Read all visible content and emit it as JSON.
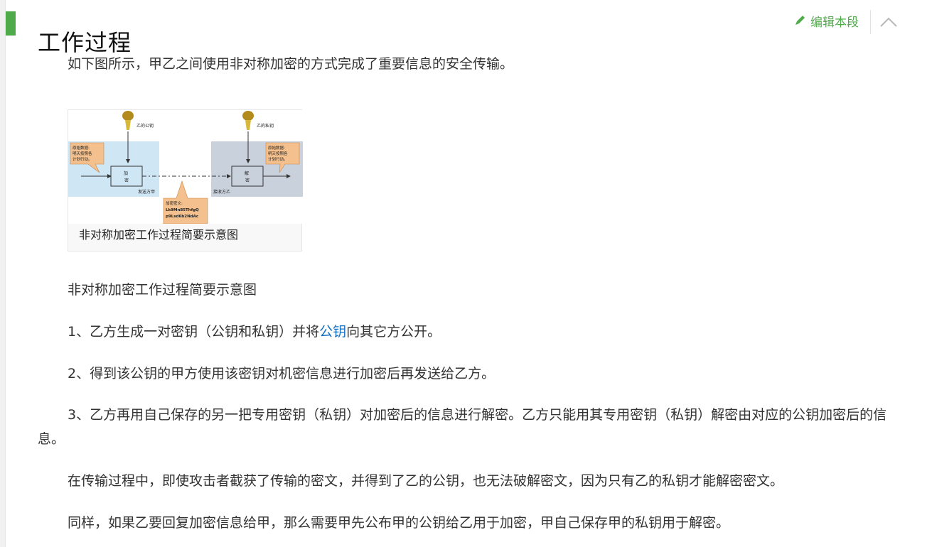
{
  "header": {
    "title": "工作过程",
    "edit_label": "编辑本段",
    "icons": {
      "edit": "pencil-icon",
      "collapse": "chevron-up-icon"
    },
    "accent_color": "#4fab49"
  },
  "intro": "如下图所示，甲乙之间使用非对称加密的方式完成了重要信息的安全传输。",
  "figure": {
    "caption": "非对称加密工作过程简要示意图",
    "diagram": {
      "public_key_label": "乙的公钥",
      "private_key_label": "乙的私钥",
      "plain_note_left": [
        "原始数据:",
        "明天按照各",
        "计划行动。"
      ],
      "plain_note_right": [
        "原始数据:",
        "明天按照各",
        "计划行动。"
      ],
      "encrypt_box": [
        "加",
        "密"
      ],
      "decrypt_box": [
        "解",
        "密"
      ],
      "sender_label": "发送方甲",
      "receiver_label": "接收方乙",
      "cipher_note": [
        "加密密文:",
        "Lk9Mn85ThfgQ",
        "p9Lsd6b2NdAc"
      ]
    }
  },
  "text_caption": "非对称加密工作过程简要示意图",
  "steps": {
    "step1_a": "1、乙方生成一对密钥（公钥和私钥）并将",
    "step1_link": "公钥",
    "step1_b": "向其它方公开。",
    "step2": "2、得到该公钥的甲方使用该密钥对机密信息进行加密后再发送给乙方。",
    "step3": "3、乙方再用自己保存的另一把专用密钥（私钥）对加密后的信息进行解密。乙方只能用其专用密钥（私钥）解密由对应的公钥加密后的信息。"
  },
  "paragraphs": {
    "security": "在传输过程中，即使攻击者截获了传输的密文，并得到了乙的公钥，也无法破解密文，因为只有乙的私钥才能解密密文。",
    "reverse": "同样，如果乙要回复加密信息给甲，那么需要甲先公布甲的公钥给乙用于加密，甲自己保存甲的私钥用于解密。"
  }
}
